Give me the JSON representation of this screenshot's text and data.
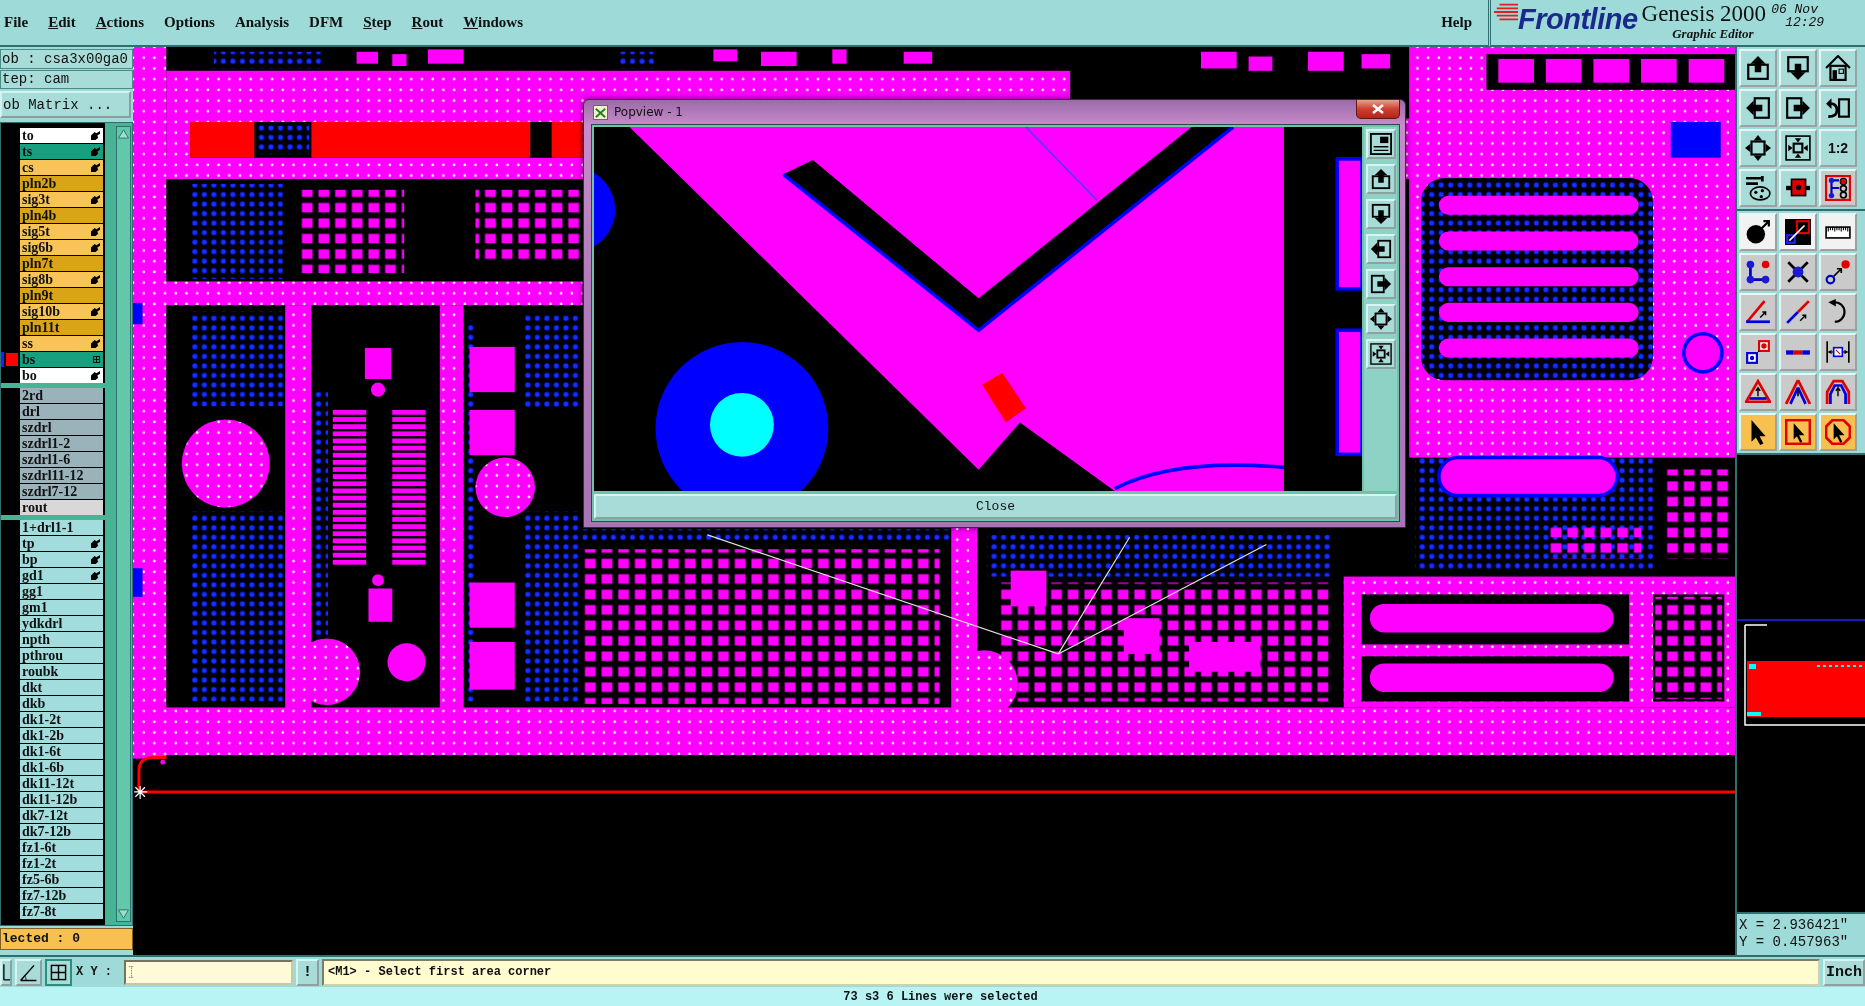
{
  "menu_bar": {
    "items": [
      {
        "label": "File",
        "mnemonic": false
      },
      {
        "label": "Edit",
        "mnemonic": true
      },
      {
        "label": "Actions",
        "mnemonic": true
      },
      {
        "label": "Options",
        "mnemonic": false
      },
      {
        "label": "Analysis",
        "mnemonic": false
      },
      {
        "label": "DFM",
        "mnemonic": false
      },
      {
        "label": "Step",
        "mnemonic": true
      },
      {
        "label": "Rout",
        "mnemonic": true
      },
      {
        "label": "Windows",
        "mnemonic": true
      }
    ],
    "help": {
      "label": "Help",
      "mnemonic": false
    }
  },
  "branding": {
    "logo": "Frontline",
    "product": "Genesis 2000",
    "subtitle": "Graphic Editor",
    "date": "06 Nov",
    "time": "12:29"
  },
  "job_panel": {
    "job": "ob : csa3x00ga0",
    "step": "tep: cam",
    "matrix_button": "ob Matrix ...",
    "layer_groups": [
      {
        "layers": [
          {
            "name": "to",
            "color": "#ffffff",
            "kind": "hand",
            "selected": false
          },
          {
            "name": "ts",
            "color": "#16a080",
            "kind": "hand",
            "selected": false
          },
          {
            "name": "cs",
            "color": "#f8c458",
            "kind": "hand",
            "selected": false
          },
          {
            "name": "pln2b",
            "color": "#daa418",
            "kind": "plain",
            "selected": false
          },
          {
            "name": "sig3t",
            "color": "#f8c458",
            "kind": "hand",
            "selected": false
          },
          {
            "name": "pln4b",
            "color": "#daa418",
            "kind": "plain",
            "selected": false
          },
          {
            "name": "sig5t",
            "color": "#f8c458",
            "kind": "hand",
            "selected": false
          },
          {
            "name": "sig6b",
            "color": "#f8c458",
            "kind": "hand",
            "selected": false
          },
          {
            "name": "pln7t",
            "color": "#daa418",
            "kind": "plain",
            "selected": false
          },
          {
            "name": "sig8b",
            "color": "#f8c458",
            "kind": "hand",
            "selected": false
          },
          {
            "name": "pln9t",
            "color": "#daa418",
            "kind": "plain",
            "selected": false
          },
          {
            "name": "sig10b",
            "color": "#f8c458",
            "kind": "hand",
            "selected": false
          },
          {
            "name": "pln11t",
            "color": "#daa418",
            "kind": "plain",
            "selected": false
          },
          {
            "name": "ss",
            "color": "#f8c458",
            "kind": "hand",
            "selected": false
          },
          {
            "name": "bs",
            "color": "#16a080",
            "kind": "box",
            "selected": true
          },
          {
            "name": "bo",
            "color": "#ffffff",
            "kind": "hand",
            "selected": false
          }
        ]
      },
      {
        "layers": [
          {
            "name": "2rd",
            "color": "#9ab2ba",
            "kind": "plain",
            "selected": false
          },
          {
            "name": "drl",
            "color": "#9ab2ba",
            "kind": "plain",
            "selected": false
          },
          {
            "name": "szdrl",
            "color": "#9ab2ba",
            "kind": "plain",
            "selected": false
          },
          {
            "name": "szdrl1-2",
            "color": "#9ab2ba",
            "kind": "plain",
            "selected": false
          },
          {
            "name": "szdrl1-6",
            "color": "#9ab2ba",
            "kind": "plain",
            "selected": false
          },
          {
            "name": "szdrl11-12",
            "color": "#9ab2ba",
            "kind": "plain",
            "selected": false
          },
          {
            "name": "szdrl7-12",
            "color": "#9ab2ba",
            "kind": "plain",
            "selected": false
          },
          {
            "name": "rout",
            "color": "#d8d8d8",
            "kind": "plain",
            "selected": false
          }
        ]
      },
      {
        "layers": [
          {
            "name": "1+drl1-1",
            "color": "#a2dcdc",
            "kind": "plain",
            "selected": false
          },
          {
            "name": "tp",
            "color": "#a2dcdc",
            "kind": "hand",
            "selected": false
          },
          {
            "name": "bp",
            "color": "#a2dcdc",
            "kind": "hand",
            "selected": false
          },
          {
            "name": "gd1",
            "color": "#a2dcdc",
            "kind": "hand",
            "selected": false
          },
          {
            "name": "gg1",
            "color": "#a2dcdc",
            "kind": "plain",
            "selected": false
          },
          {
            "name": "gm1",
            "color": "#a2dcdc",
            "kind": "plain",
            "selected": false
          },
          {
            "name": "ydkdrl",
            "color": "#a2dcdc",
            "kind": "plain",
            "selected": false
          },
          {
            "name": "npth",
            "color": "#a2dcdc",
            "kind": "plain",
            "selected": false
          },
          {
            "name": "pthrou",
            "color": "#a2dcdc",
            "kind": "plain",
            "selected": false
          },
          {
            "name": "roubk",
            "color": "#a2dcdc",
            "kind": "plain",
            "selected": false
          },
          {
            "name": "dkt",
            "color": "#a2dcdc",
            "kind": "plain",
            "selected": false
          },
          {
            "name": "dkb",
            "color": "#a2dcdc",
            "kind": "plain",
            "selected": false
          },
          {
            "name": "dk1-2t",
            "color": "#a2dcdc",
            "kind": "plain",
            "selected": false
          },
          {
            "name": "dk1-2b",
            "color": "#a2dcdc",
            "kind": "plain",
            "selected": false
          },
          {
            "name": "dk1-6t",
            "color": "#a2dcdc",
            "kind": "plain",
            "selected": false
          },
          {
            "name": "dk1-6b",
            "color": "#a2dcdc",
            "kind": "plain",
            "selected": false
          },
          {
            "name": "dk11-12t",
            "color": "#a2dcdc",
            "kind": "plain",
            "selected": false
          },
          {
            "name": "dk11-12b",
            "color": "#a2dcdc",
            "kind": "plain",
            "selected": false
          },
          {
            "name": "dk7-12t",
            "color": "#a2dcdc",
            "kind": "plain",
            "selected": false
          },
          {
            "name": "dk7-12b",
            "color": "#a2dcdc",
            "kind": "plain",
            "selected": false
          },
          {
            "name": "fz1-6t",
            "color": "#a2dcdc",
            "kind": "plain",
            "selected": false
          },
          {
            "name": "fz1-2t",
            "color": "#a2dcdc",
            "kind": "plain",
            "selected": false
          },
          {
            "name": "fz5-6b",
            "color": "#a2dcdc",
            "kind": "plain",
            "selected": false
          },
          {
            "name": "fz7-12b",
            "color": "#a2dcdc",
            "kind": "plain",
            "selected": false
          },
          {
            "name": "fz7-8t",
            "color": "#a2dcdc",
            "kind": "plain",
            "selected": false
          }
        ]
      }
    ],
    "selected_count": "lected : 0"
  },
  "popview": {
    "title": "Popview - 1",
    "close_button": "Close"
  },
  "toolbar": {
    "scale_button": "1:2"
  },
  "coordinates": {
    "x": "X = 2.936421\"",
    "y": "Y = 0.457963\""
  },
  "command_line": {
    "label": "X Y :",
    "alert_button": "!",
    "prompt": "<M1> - Select first area corner",
    "units_button": "Inch"
  },
  "status_bar": {
    "message": "73 s3 6 Lines were selected"
  }
}
